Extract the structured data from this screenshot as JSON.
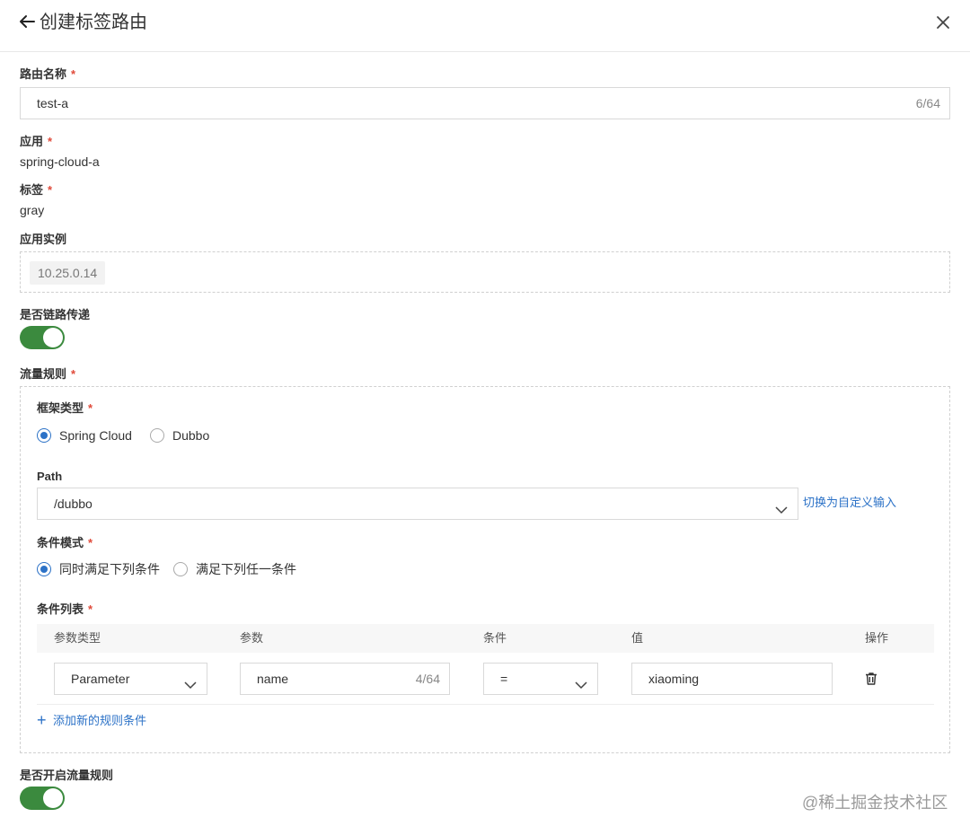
{
  "header": {
    "title": "创建标签路由"
  },
  "route_name": {
    "label": "路由名称",
    "value": "test-a",
    "counter": "6/64"
  },
  "application": {
    "label": "应用",
    "value": "spring-cloud-a"
  },
  "tag": {
    "label": "标签",
    "value": "gray"
  },
  "instances": {
    "label": "应用实例",
    "items": [
      "10.25.0.14"
    ]
  },
  "link_propagation": {
    "label": "是否链路传递",
    "enabled": true
  },
  "traffic_rules": {
    "label": "流量规则",
    "framework": {
      "label": "框架类型",
      "options": [
        "Spring Cloud",
        "Dubbo"
      ],
      "selected": "Spring Cloud"
    },
    "path": {
      "label": "Path",
      "value": "/dubbo",
      "switch_link": "切换为自定义输入"
    },
    "condition_mode": {
      "label": "条件模式",
      "options": [
        "同时满足下列条件",
        "满足下列任一条件"
      ],
      "selected": "同时满足下列条件"
    },
    "condition_list": {
      "label": "条件列表",
      "columns": [
        "参数类型",
        "参数",
        "条件",
        "值",
        "操作"
      ],
      "rows": [
        {
          "param_type": "Parameter",
          "param": "name",
          "param_counter": "4/64",
          "operator": "=",
          "value": "xiaoming"
        }
      ],
      "add_label": "添加新的规则条件"
    }
  },
  "traffic_rule_enabled": {
    "label": "是否开启流量规则",
    "enabled": true
  },
  "watermark": "@稀土掘金技术社区",
  "colors": {
    "accent": "#2c72c7",
    "switch_on": "#3b8a3e",
    "required": "#e04a3a"
  }
}
